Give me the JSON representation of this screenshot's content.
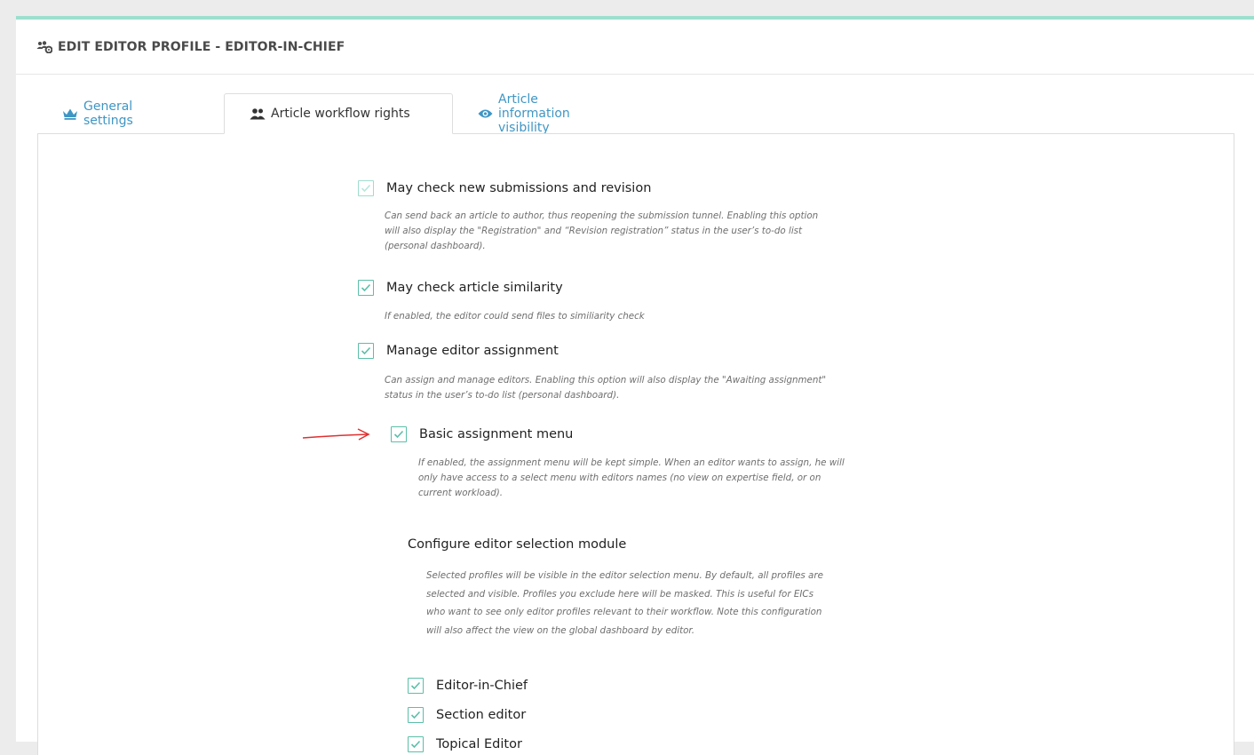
{
  "header": {
    "title": "EDIT EDITOR PROFILE - EDITOR-IN-CHIEF",
    "icon": "users-cog-icon"
  },
  "tabs": [
    {
      "label": "General settings",
      "icon": "crown-icon",
      "active": false
    },
    {
      "label": "Article workflow rights",
      "icon": "users-icon",
      "active": true
    },
    {
      "label": "Article information visibility",
      "icon": "eye-icon",
      "active": false
    }
  ],
  "options": [
    {
      "label": "May check new submissions and revision",
      "checked": true,
      "help": [
        "Can send back an article to author, thus reopening the submission tunnel. Enabling this option",
        "will also display the \"Registration\" and “Revision registration” status in the user’s to-do list",
        "(personal dashboard)."
      ]
    },
    {
      "label": "May check article similarity",
      "checked": true,
      "help": [
        "If enabled, the editor could send files to similiarity check"
      ]
    },
    {
      "label": "Manage editor assignment",
      "checked": true,
      "help": [
        "Can assign and manage editors. Enabling this option will also display the \"Awaiting assignment\"",
        "status in the user’s to-do list (personal dashboard)."
      ]
    },
    {
      "label": "Basic assignment menu",
      "checked": true,
      "help": [
        "If enabled, the assignment menu will be kept simple. When an editor wants to assign, he will",
        "only have access to a select menu with editors names (no view on expertise field, or on",
        "current workload)."
      ]
    }
  ],
  "selection_module": {
    "title": "Configure editor selection module",
    "help": [
      "Selected profiles will be visible in the editor selection menu. By default, all profiles are",
      "selected and visible. Profiles you exclude here will be masked. This is useful for EICs",
      "who want to see only editor profiles relevant to their workflow. Note this configuration",
      "will also affect the view on the global dashboard by editor."
    ],
    "profiles": [
      {
        "label": "Editor-in-Chief",
        "checked": true
      },
      {
        "label": "Section editor",
        "checked": true
      },
      {
        "label": "Topical Editor",
        "checked": true
      }
    ]
  },
  "colors": {
    "accent_border": "#9ddfcf",
    "checkbox": "#5bbfa8",
    "tab_link": "#3f96c4",
    "annotation_arrow": "#e03030"
  }
}
